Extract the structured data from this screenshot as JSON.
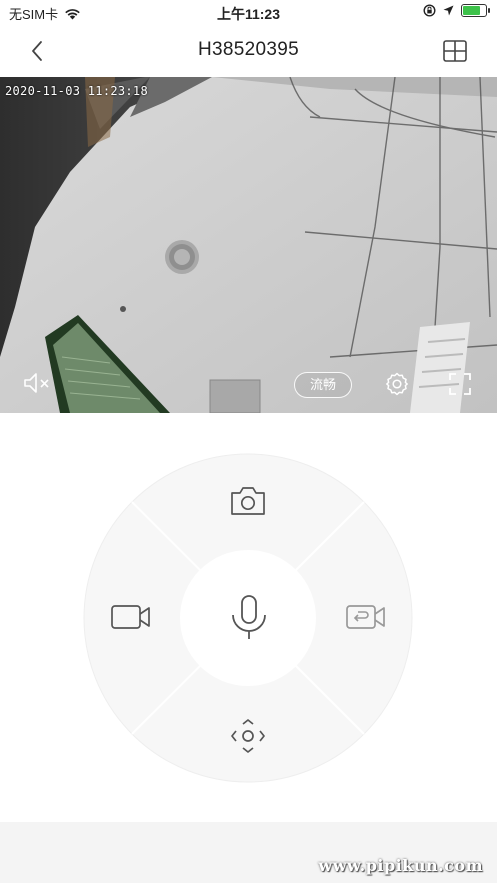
{
  "status_bar": {
    "carrier": "无SIM卡",
    "time": "上午11:23"
  },
  "nav": {
    "title": "H38520395"
  },
  "video": {
    "timestamp": "2020-11-03 11:23:18",
    "quality_label": "流畅"
  },
  "controls": {
    "snapshot_icon": "camera-icon",
    "record_icon": "video-record-icon",
    "playback_icon": "playback-icon",
    "talk_icon": "microphone-icon",
    "ptz_icon": "ptz-direction-icon"
  },
  "watermark": "www.pipikun.com"
}
